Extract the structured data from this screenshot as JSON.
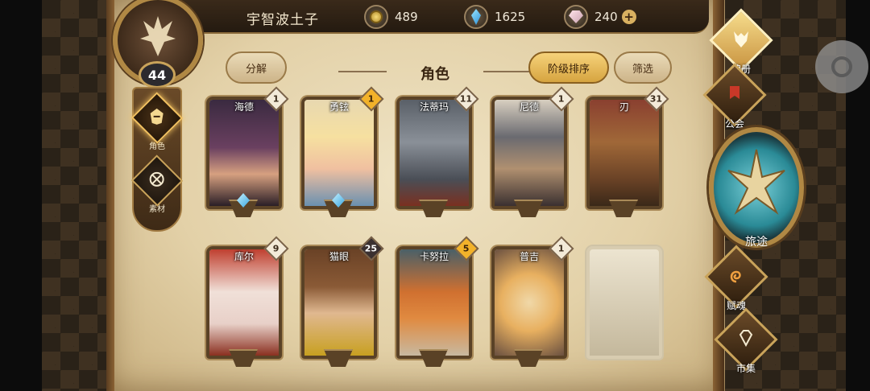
{
  "player": {
    "name": "宇智波土子",
    "level": "44"
  },
  "resources": [
    {
      "icon": "gold-coin-icon",
      "value": "489"
    },
    {
      "icon": "blue-crystal-icon",
      "value": "1625"
    },
    {
      "icon": "soul-gem-icon",
      "value": "240"
    }
  ],
  "left_tabs": [
    {
      "label": "角色",
      "icon": "hero-helmet-icon",
      "active": true
    },
    {
      "label": "素材",
      "icon": "material-icon",
      "active": false
    }
  ],
  "toolbar": {
    "disassemble": "分解",
    "title": "角色",
    "sort": "阶级排序",
    "filter": "筛选"
  },
  "heroes": [
    {
      "name": "海德",
      "tier": "1",
      "tier_style": "white",
      "gem": true
    },
    {
      "name": "勇铉",
      "tier": "1",
      "tier_style": "gold",
      "gem": true
    },
    {
      "name": "法蒂玛",
      "tier": "11",
      "tier_style": "white",
      "gem": false
    },
    {
      "name": "尼德",
      "tier": "1",
      "tier_style": "white",
      "gem": false
    },
    {
      "name": "刃",
      "tier": "31",
      "tier_style": "white",
      "gem": false
    },
    {
      "name": "库尔",
      "tier": "9",
      "tier_style": "white",
      "gem": false
    },
    {
      "name": "猫眼",
      "tier": "25",
      "tier_style": "dark",
      "gem": false
    },
    {
      "name": "卡努拉",
      "tier": "5",
      "tier_style": "gold",
      "gem": false
    },
    {
      "name": "普吉",
      "tier": "1",
      "tier_style": "white",
      "gem": false
    }
  ],
  "side_menu": [
    {
      "label": "魂册",
      "icon": "wolf-head-icon",
      "active": true
    },
    {
      "label": "公会",
      "icon": "guild-banner-icon",
      "active": false
    },
    {
      "label": "旅途",
      "icon": "compass-emblem-icon",
      "active": false
    },
    {
      "label": "赋魂",
      "icon": "spiral-icon",
      "active": false
    },
    {
      "label": "市集",
      "icon": "gem-market-icon",
      "active": false
    }
  ],
  "colors": {
    "accent_gold": "#d6a440",
    "parchment": "#e3d1a8",
    "frame_brown": "#5a4226"
  }
}
